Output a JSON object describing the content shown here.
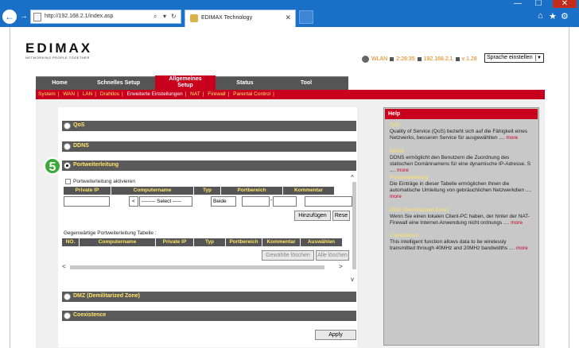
{
  "browser": {
    "url": "http://192.168.2.1/index.asp",
    "tab_title": "EDIMAX Technology",
    "min": "—",
    "max": "☐",
    "close": "✕"
  },
  "header": {
    "logo": "EDIMAX",
    "tagline": "NETWORKING PEOPLE TOGETHER",
    "wlan_label": "WLAN",
    "time": "2:28:35",
    "ip": "192.168.2.1",
    "version": "v 1.28",
    "language": "Sprache einstellen"
  },
  "menu": {
    "items": [
      "Home",
      "Schnelles Setup",
      "Allgemeines",
      "Setup",
      "Status",
      "Tool"
    ]
  },
  "submenu": {
    "items": [
      "System",
      "WAN",
      "LAN",
      "Drahtlos",
      "Erweiterte Einstellungen",
      "NAT",
      "Firewall",
      "Parental Control"
    ]
  },
  "sections": {
    "qos": "QoS",
    "ddns": "DDNS",
    "pf": "Portweiterleitung",
    "dmz": "DMZ (Demilitarized Zone)",
    "coex": "Coexistence",
    "step": "5"
  },
  "pf": {
    "enable_label": "Portweiterleitung aktivieren",
    "cols": [
      "Private IP",
      "Computername",
      "Typ",
      "Portbereich",
      "Kommentar"
    ],
    "arrow_btn": "<",
    "select_value": "-------- Select -----",
    "typ_value": "Beide",
    "dash": "-",
    "add_btn": "Hinzufügen",
    "reset_btn": "Rese",
    "current_title": "Gegenwärtige Portweiterleitung Tabelle :",
    "cur_cols": [
      "NO.",
      "Computername",
      "Private IP",
      "Typ",
      "Portbereich",
      "Kommentar",
      "Auswählen"
    ],
    "del_sel": "Gewählte löschen",
    "del_all": "Alle löschen",
    "apply": "Apply"
  },
  "help": {
    "title": "Help",
    "qos_t": "QoS",
    "qos_d": "Quality of Service (QoS) bezieht sich auf die Fähigkeit eines Netzwerks, besseren Service für ausgewählten ....",
    "ddns_t": "DDNS",
    "ddns_d": "DDNS ermöglicht den Benutzern die Zuordnung des statischen Domännamens für eine dynamische IP-Adresse. S ....",
    "pf_t": "Portweiterleitung",
    "pf_d": "Die Einträge in dieser Tabelle ermöglichen Ihnen die automatische Umleitung von gebräuchlichen Netzwerkdien ....",
    "dmz_t": "DMZ (Demilitarized Zone)",
    "dmz_d": "Wenn Sie einen lokalen Client-PC haben, der hinter der NAT-Firewall eine Internet-Anwendung nicht ordnungs ....",
    "coex_t": "Coexistence",
    "coex_d": "This intelligent function allows data to be wirelessly transmitted through 40MHz and 20MHz bandwidths  ....",
    "more": "more"
  }
}
